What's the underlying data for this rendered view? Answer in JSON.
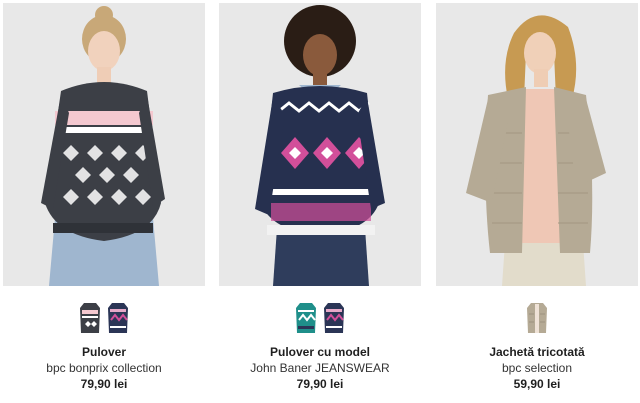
{
  "products": [
    {
      "name": "Pulover",
      "brand": "bpc bonprix collection",
      "price": "79,90 lei",
      "swatches": [
        "grey-pink-pattern-sweater-icon",
        "navy-pink-pattern-sweater-icon"
      ]
    },
    {
      "name": "Pulover cu model",
      "brand": "John Baner JEANSWEAR",
      "price": "79,90 lei",
      "swatches": [
        "teal-pattern-sweater-icon",
        "navy-pink-pattern-sweater-icon"
      ]
    },
    {
      "name": "Jachetă tricotată",
      "brand": "bpc selection",
      "price": "59,90 lei",
      "swatches": [
        "beige-cardigan-icon"
      ]
    }
  ],
  "colors": {
    "page_background": "#ffffff",
    "photo_background": "#e9e9e9",
    "text": "#1f1f1f"
  }
}
